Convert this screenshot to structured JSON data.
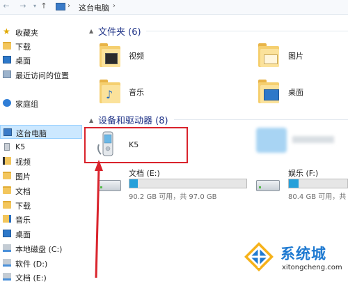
{
  "address_bar": {
    "back_glyph": "←",
    "forward_glyph": "→",
    "dropdown_glyph": "▾",
    "up_glyph": "↑",
    "separator": "›",
    "location": "这台电脑"
  },
  "sidebar": {
    "items": [
      {
        "label": "收藏夹",
        "icon": "star-icon"
      },
      {
        "label": "下载",
        "icon": "downloads-folder-icon"
      },
      {
        "label": "桌面",
        "icon": "desktop-icon"
      },
      {
        "label": "最近访问的位置",
        "icon": "recent-places-icon"
      },
      {
        "label": "家庭组",
        "icon": "homegroup-icon"
      },
      {
        "label": "这台电脑",
        "icon": "computer-icon"
      },
      {
        "label": "K5",
        "icon": "phone-icon"
      },
      {
        "label": "视频",
        "icon": "videos-folder-icon"
      },
      {
        "label": "图片",
        "icon": "pictures-folder-icon"
      },
      {
        "label": "文档",
        "icon": "documents-folder-icon"
      },
      {
        "label": "下载",
        "icon": "downloads-folder-icon"
      },
      {
        "label": "音乐",
        "icon": "music-folder-icon"
      },
      {
        "label": "桌面",
        "icon": "desktop-icon"
      },
      {
        "label": "本地磁盘 (C:)",
        "icon": "drive-icon"
      },
      {
        "label": "软件 (D:)",
        "icon": "drive-icon"
      },
      {
        "label": "文档 (E:)",
        "icon": "drive-icon"
      }
    ],
    "selected_label": "这台电脑"
  },
  "content": {
    "folders_header": "文件夹 (6)",
    "folders": [
      {
        "label": "视频",
        "icon": "videos-folder-icon"
      },
      {
        "label": "图片",
        "icon": "pictures-folder-icon"
      },
      {
        "label": "音乐",
        "icon": "music-folder-icon"
      },
      {
        "label": "桌面",
        "icon": "desktop-folder-icon"
      }
    ],
    "devices_header": "设备和驱动器 (8)",
    "device_k5": {
      "label": "K5",
      "icon": "phone-icon"
    },
    "drives": [
      {
        "label": "文档 (E:)",
        "free": "90.2 GB 可用，共 97.0 GB",
        "used_fraction": 0.07
      },
      {
        "label": "娱乐 (F:)",
        "free": "80.4 GB 可用，共",
        "used_fraction": 0.17
      }
    ]
  },
  "annotation": {
    "highlight_color": "#d9232c"
  },
  "watermark": {
    "name_cn": "系统城",
    "url": "xitongcheng.com"
  },
  "colors": {
    "selection_bg": "#cce8ff",
    "header_text": "#1e3287",
    "drive_fill": "#26a0da"
  }
}
